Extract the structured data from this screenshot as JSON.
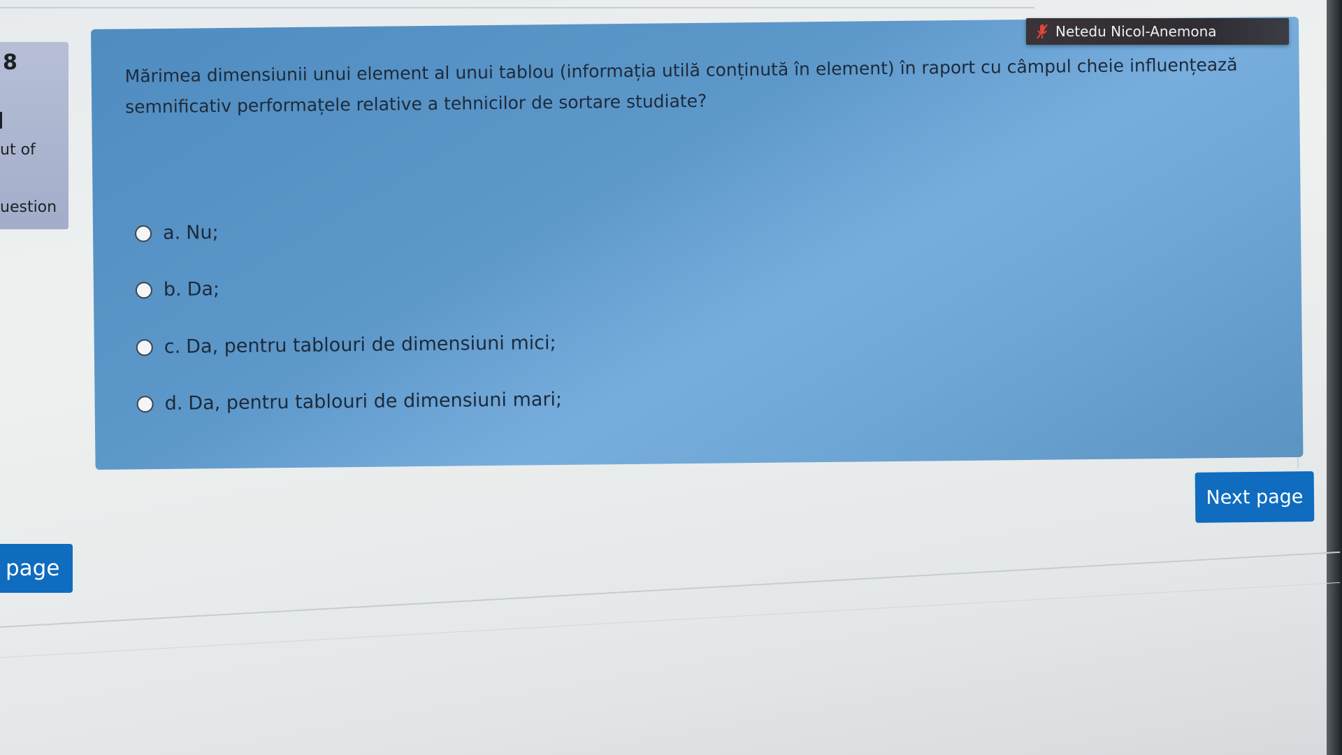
{
  "question_info": {
    "number": "8",
    "marks_text": "ut of",
    "flag_text": "uestion"
  },
  "question": {
    "text": "Mărimea dimensiunii unui element al unui tablou (informația utilă conținută în element) în raport cu câmpul cheie influențează semnificativ performațele relative a tehnicilor de sortare studiate?",
    "answers": [
      {
        "letter": "a.",
        "text": "Nu;"
      },
      {
        "letter": "b.",
        "text": "Da;"
      },
      {
        "letter": "c.",
        "text": "Da, pentru tablouri de dimensiuni mici;"
      },
      {
        "letter": "d.",
        "text": "Da, pentru tablouri de dimensiuni mari;"
      }
    ]
  },
  "user": {
    "name": "Netedu Nicol-Anemona",
    "mic_icon": "mic-muted-icon"
  },
  "navigation": {
    "next_label": "Next page",
    "previous_label": "page"
  },
  "colors": {
    "accent": "#0f6cbf",
    "content_bg": "#5d98ca",
    "info_bg": "#b6bfd6"
  }
}
